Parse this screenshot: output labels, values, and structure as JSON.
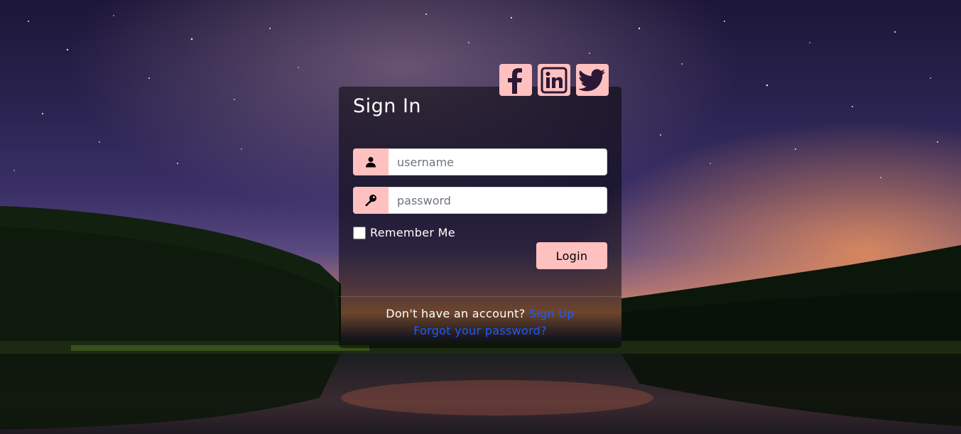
{
  "colors": {
    "accent": "#FFC0C0",
    "link": "#1a5cff",
    "card_bg": "rgba(0,0,0,0.5)"
  },
  "form": {
    "title": "Sign In",
    "username": {
      "icon": "user-icon",
      "value": "",
      "placeholder": "username"
    },
    "password": {
      "icon": "key-icon",
      "value": "",
      "placeholder": "password"
    },
    "remember_label": "Remember Me",
    "remember_checked": false,
    "login_label": "Login"
  },
  "social": [
    {
      "name": "facebook",
      "icon": "facebook-icon"
    },
    {
      "name": "linkedin",
      "icon": "linkedin-icon"
    },
    {
      "name": "twitter",
      "icon": "twitter-icon"
    }
  ],
  "footer": {
    "signup_prompt": "Don't have an account?",
    "signup_link": "Sign Up",
    "forgot_link": "Forgot your password?"
  }
}
